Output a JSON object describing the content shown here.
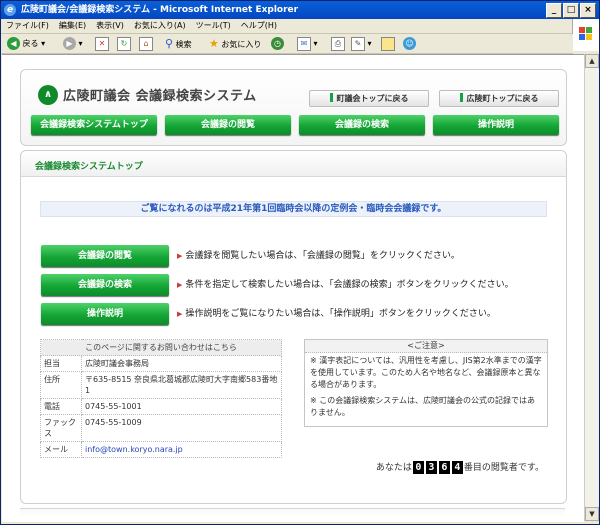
{
  "window": {
    "title": "広陵町議会/会議録検索システム - Microsoft Internet Explorer",
    "logo_glyph": "e",
    "btn_min": "_",
    "btn_max": "□",
    "btn_close": "×"
  },
  "menu": [
    "ファイル(F)",
    "編集(E)",
    "表示(V)",
    "お気に入り(A)",
    "ツール(T)",
    "ヘルプ(H)"
  ],
  "toolbar": {
    "back": "戻る",
    "search": "検索",
    "favorites": "お気に入り"
  },
  "site": {
    "logo_glyph": "∧",
    "title": "広陵町議会 会議録検索システム",
    "top_buttons": [
      "町議会トップに戻る",
      "広陵町トップに戻る"
    ],
    "nav": [
      "会議録検索システムトップ",
      "会議録の閲覧",
      "会議録の検索",
      "操作説明"
    ]
  },
  "main": {
    "section_title": "会議録検索システムトップ",
    "notice": "ご覧になれるのは平成21年第1回臨時会以降の定例会・臨時会会議録です。",
    "actions": [
      {
        "label": "会議録の閲覧",
        "desc": "会議録を閲覧したい場合は、「会議録の閲覧」をクリックください。"
      },
      {
        "label": "会議録の検索",
        "desc": "条件を指定して検索したい場合は、「会議録の検索」ボタンをクリックください。"
      },
      {
        "label": "操作説明",
        "desc": "操作説明をご覧になりたい場合は、「操作説明」ボタンをクリックください。"
      }
    ],
    "contact": {
      "title": "このページに関するお問い合わせはこちら",
      "rows": [
        {
          "label": "担当",
          "value": "広陵町議会事務局"
        },
        {
          "label": "住所",
          "value": "〒635-8515 奈良県北葛城郡広陵町大字南郷583番地1"
        },
        {
          "label": "電話",
          "value": "0745-55-1001"
        },
        {
          "label": "ファックス",
          "value": "0745-55-1009"
        },
        {
          "label": "メール",
          "value": "info@town.koryo.nara.jp"
        }
      ]
    },
    "caution": {
      "title": "<ご注意>",
      "lines": [
        "※ 漢字表記については、汎用性を考慮し、JIS第2水準までの漢字を使用しています。このため人名や地名など、会議録原本と異なる場合があります。",
        "※ この会議録検索システムは、広陵町議会の公式の記録ではありません。"
      ]
    },
    "counter": {
      "prefix": "あなたは",
      "digits": [
        "0",
        "3",
        "6",
        "4"
      ],
      "suffix": "番目の閲覧者です。"
    }
  }
}
